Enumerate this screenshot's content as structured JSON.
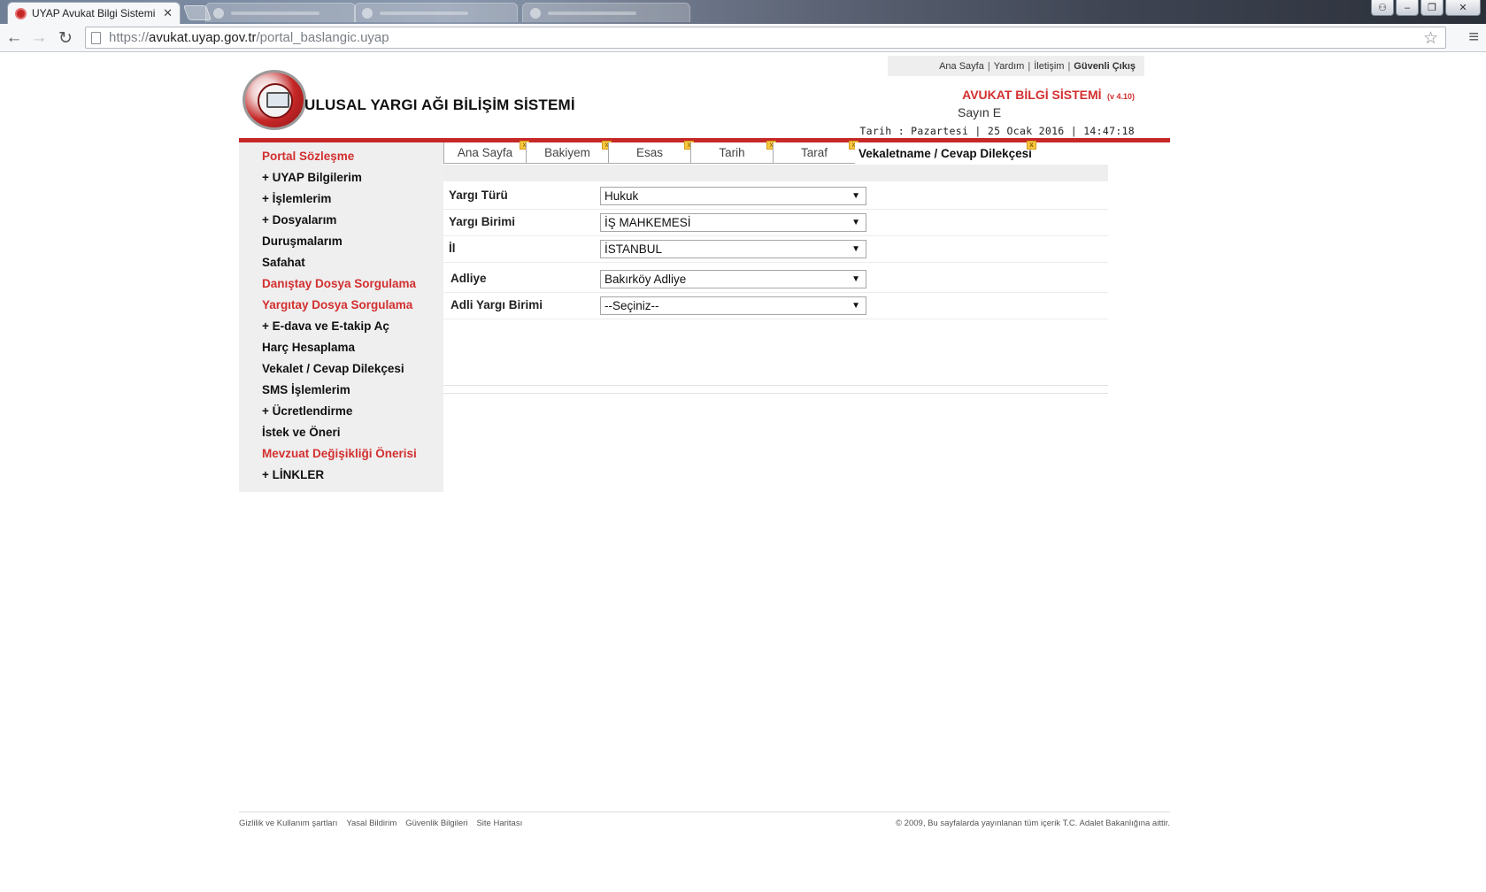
{
  "browser": {
    "tab_title": "UYAP Avukat Bilgi Sistemi",
    "tab_close": "✕",
    "url_scheme": "https://",
    "url_host": "avukat.uyap.gov.tr",
    "url_path": "/portal_baslangic.uyap",
    "back_icon": "←",
    "forward_icon": "→",
    "reload_icon": "↻",
    "star_icon": "☆",
    "menu_icon": "≡",
    "win_user": "⚇",
    "win_minimize": "‒",
    "win_restore": "❐",
    "win_close": "✕"
  },
  "top_links": {
    "home": "Ana Sayfa",
    "help": "Yardım",
    "contact": "İletişim",
    "logout": "Güvenli Çıkış",
    "separator": "|"
  },
  "header": {
    "site_title": "ULUSAL YARGI AĞI BİLİŞİM SİSTEMİ",
    "system_name": "AVUKAT BİLGİ SİSTEMİ",
    "system_version": "(v 4.10)",
    "greeting": "Sayın E",
    "date_line": "Tarih : Pazartesi | 25 Ocak 2016 | 14:47:18"
  },
  "sidebar": {
    "items": [
      {
        "label": "Portal Sözleşme",
        "color": "#d32f2f"
      },
      {
        "label": "+ UYAP Bilgilerim",
        "color": "#111111"
      },
      {
        "label": "+ İşlemlerim",
        "color": "#111111"
      },
      {
        "label": "+ Dosyalarım",
        "color": "#111111"
      },
      {
        "label": "Duruşmalarım",
        "color": "#111111"
      },
      {
        "label": "Safahat",
        "color": "#111111"
      },
      {
        "label": "Danıştay Dosya Sorgulama",
        "color": "#d32f2f"
      },
      {
        "label": "Yargıtay Dosya Sorgulama",
        "color": "#d32f2f"
      },
      {
        "label": "+ E-dava ve E-takip Aç",
        "color": "#111111"
      },
      {
        "label": "Harç Hesaplama",
        "color": "#111111"
      },
      {
        "label": "Vekalet / Cevap Dilekçesi",
        "color": "#111111"
      },
      {
        "label": "SMS İşlemlerim",
        "color": "#111111"
      },
      {
        "label": "+ Ücretlendirme",
        "color": "#111111"
      },
      {
        "label": "İstek ve Öneri",
        "color": "#111111"
      },
      {
        "label": "Mevzuat Değişikliği Önerisi",
        "color": "#d32f2f"
      },
      {
        "label": "+ LİNKLER",
        "color": "#111111"
      }
    ]
  },
  "tabs": [
    {
      "label": "Ana Sayfa"
    },
    {
      "label": "Bakiyem"
    },
    {
      "label": "Esas"
    },
    {
      "label": "Tarih"
    },
    {
      "label": "Taraf"
    },
    {
      "label": "Vekaletname / Cevap Dilekçesi",
      "active": true
    }
  ],
  "form": {
    "rows": [
      {
        "label": "Yargı Türü",
        "value": "Hukuk"
      },
      {
        "label": "Yargı Birimi",
        "value": "İŞ MAHKEMESİ"
      },
      {
        "label": "İl",
        "value": "İSTANBUL"
      },
      {
        "label": "Adliye",
        "value": "Bakırköy Adliye"
      },
      {
        "label": "Adli Yargı Birimi",
        "value": "--Seçiniz--"
      }
    ],
    "select_arrow": "▼"
  },
  "footer": {
    "links": [
      "Gizlilik ve Kullanım şartları",
      "Yasal Bildirim",
      "Güvenlik Bilgileri",
      "Site Haritası"
    ],
    "copyright": "© 2009, Bu sayfalarda yayınlanan tüm içerik T.C. Adalet Bakanlığına aittir."
  },
  "colors": {
    "accent_red": "#c62828",
    "link_red": "#d32f2f"
  }
}
